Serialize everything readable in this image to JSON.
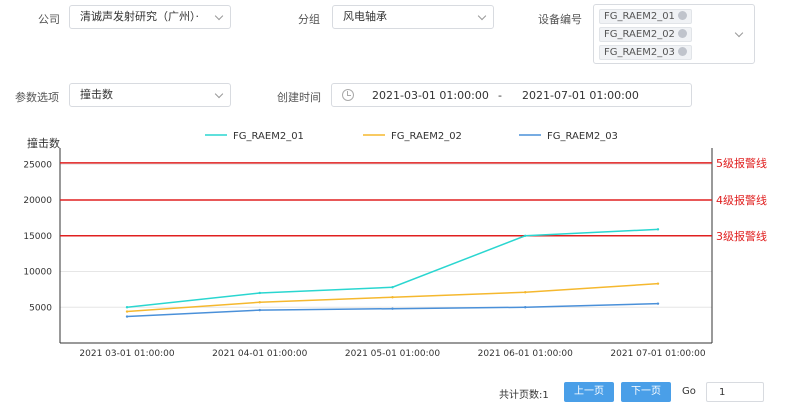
{
  "filters": {
    "company_label": "公司",
    "company_value": "清诚声发射研究（广州）·",
    "group_label": "分组",
    "group_value": "风电轴承",
    "device_label": "设备编号",
    "device_tags": [
      "FG_RAEM2_01",
      "FG_RAEM2_02",
      "FG_RAEM2_03"
    ],
    "param_label": "参数选项",
    "param_value": "撞击数",
    "time_label": "创建时间",
    "time_start": "2021-03-01 01:00:00",
    "time_separator": "-",
    "time_end": "2021-07-01 01:00:00"
  },
  "chart_data": {
    "type": "line",
    "ylabel": "撞击数",
    "categories": [
      "2021 03-01 01:00:00",
      "2021 04-01 01:00:00",
      "2021 05-01 01:00:00",
      "2021 06-01 01:00:00",
      "2021 07-01 01:00:00"
    ],
    "yticks": [
      5000,
      10000,
      15000,
      20000,
      25000
    ],
    "ylim": [
      0,
      27000
    ],
    "legend_position": "top",
    "series": [
      {
        "name": "FG_RAEM2_01",
        "color": "#2ad6d0",
        "values": [
          5000,
          7000,
          7800,
          15000,
          15900
        ]
      },
      {
        "name": "FG_RAEM2_02",
        "color": "#f5b82e",
        "values": [
          4400,
          5700,
          6400,
          7100,
          8300
        ]
      },
      {
        "name": "FG_RAEM2_03",
        "color": "#4a90d9",
        "values": [
          3700,
          4600,
          4800,
          5000,
          5500
        ]
      }
    ],
    "thresholds": [
      {
        "label": "5级报警线",
        "value": 25200,
        "color": "#e02020"
      },
      {
        "label": "4级报警线",
        "value": 20000,
        "color": "#e02020"
      },
      {
        "label": "3级报警线",
        "value": 15000,
        "color": "#e02020"
      }
    ]
  },
  "pager": {
    "total_text": "共计页数:1",
    "prev_label": "上一页",
    "next_label": "下一页",
    "go_label": "Go",
    "page_value": "1"
  }
}
